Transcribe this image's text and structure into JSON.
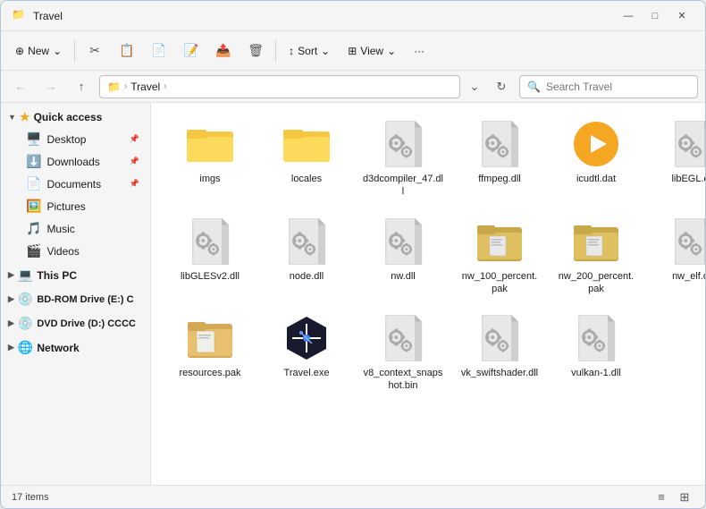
{
  "window": {
    "title": "Travel",
    "title_icon": "📁"
  },
  "titlebar": {
    "minimize": "—",
    "maximize": "□",
    "close": "✕"
  },
  "toolbar": {
    "new_label": "New",
    "new_chevron": "⌄",
    "sort_label": "Sort",
    "sort_chevron": "⌄",
    "view_label": "View",
    "view_chevron": "⌄",
    "more_label": "···"
  },
  "addressbar": {
    "back_btn": "←",
    "forward_btn": "→",
    "up_btn": "↑",
    "path_icon": "📁",
    "path_chevron": "›",
    "path_segment": "Travel",
    "path_suffix": "›",
    "refresh": "↻",
    "search_placeholder": "Search Travel"
  },
  "sidebar": {
    "quick_access_label": "Quick access",
    "items": [
      {
        "id": "desktop",
        "label": "Desktop",
        "icon": "🖥️",
        "pinned": true
      },
      {
        "id": "downloads",
        "label": "Downloads",
        "icon": "⬇️",
        "pinned": true
      },
      {
        "id": "documents",
        "label": "Documents",
        "icon": "📄",
        "pinned": true
      },
      {
        "id": "pictures",
        "label": "Pictures",
        "icon": "🖼️",
        "pinned": false
      },
      {
        "id": "music",
        "label": "Music",
        "icon": "🎵",
        "pinned": false
      },
      {
        "id": "videos",
        "label": "Videos",
        "icon": "🎬",
        "pinned": false
      }
    ],
    "this_pc_label": "This PC",
    "bdrom_label": "BD-ROM Drive (E:) C",
    "dvd_label": "DVD Drive (D:) CCCC",
    "network_label": "Network"
  },
  "files": [
    {
      "id": "imgs",
      "name": "imgs",
      "type": "folder"
    },
    {
      "id": "locales",
      "name": "locales",
      "type": "folder"
    },
    {
      "id": "d3dcompiler",
      "name": "d3dcompiler_47.dll",
      "type": "dll"
    },
    {
      "id": "ffmpeg",
      "name": "ffmpeg.dll",
      "type": "dll"
    },
    {
      "id": "icudtl",
      "name": "icudtl.dat",
      "type": "dat"
    },
    {
      "id": "libEGL",
      "name": "libEGL.dll",
      "type": "dll"
    },
    {
      "id": "libGLES",
      "name": "libGLESv2.dll",
      "type": "dll"
    },
    {
      "id": "node",
      "name": "node.dll",
      "type": "dll"
    },
    {
      "id": "nw",
      "name": "nw.dll",
      "type": "dll"
    },
    {
      "id": "nw100",
      "name": "nw_100_percent.pak",
      "type": "pak"
    },
    {
      "id": "nw200",
      "name": "nw_200_percent.pak",
      "type": "pak"
    },
    {
      "id": "nw_elf",
      "name": "nw_elf.dll",
      "type": "dll"
    },
    {
      "id": "resources",
      "name": "resources.pak",
      "type": "pak2"
    },
    {
      "id": "travel",
      "name": "Travel.exe",
      "type": "exe"
    },
    {
      "id": "v8context",
      "name": "v8_context_snapshot.bin",
      "type": "dll"
    },
    {
      "id": "vkswift",
      "name": "vk_swiftshader.dll",
      "type": "dll"
    },
    {
      "id": "vulkan",
      "name": "vulkan-1.dll",
      "type": "dll"
    }
  ],
  "statusbar": {
    "count_label": "17 items"
  }
}
